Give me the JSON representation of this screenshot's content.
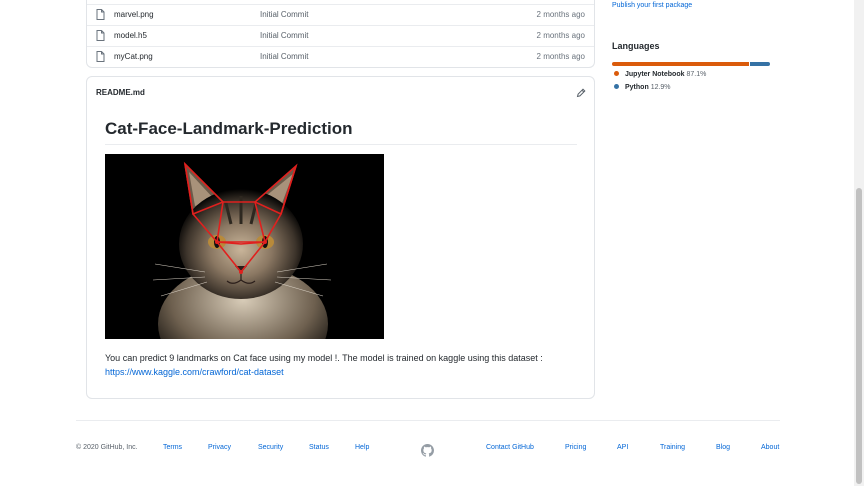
{
  "files": [
    {
      "name": "marvel.png",
      "message": "Initial Commit",
      "age": "2 months ago"
    },
    {
      "name": "model.h5",
      "message": "Initial Commit",
      "age": "2 months ago"
    },
    {
      "name": "myCat.png",
      "message": "Initial Commit",
      "age": "2 months ago"
    }
  ],
  "readme": {
    "header": "README.md",
    "title": "Cat-Face-Landmark-Prediction",
    "image_alt": "cat face with landmark lines",
    "description": "You can predict 9 landmarks on Cat face using my model !. The model is trained on kaggle using this dataset :",
    "link": "https://www.kaggle.com/crawford/cat-dataset"
  },
  "sidebar": {
    "publish_link": "Publish your first package",
    "languages_heading": "Languages",
    "languages": [
      {
        "name": "Jupyter Notebook",
        "percent": "87.1%",
        "value": 87.1,
        "color": "#DA5B0B"
      },
      {
        "name": "Python",
        "percent": "12.9%",
        "value": 12.9,
        "color": "#3572A5"
      }
    ]
  },
  "footer": {
    "copyright": "© 2020 GitHub, Inc.",
    "links_left": [
      "Terms",
      "Privacy",
      "Security",
      "Status",
      "Help"
    ],
    "links_right": [
      "Contact GitHub",
      "Pricing",
      "API",
      "Training",
      "Blog",
      "About"
    ]
  },
  "colors": {
    "link": "#0366d6",
    "border": "#e1e4e8",
    "text": "#24292e",
    "landmark_lines": "#e0201e"
  }
}
